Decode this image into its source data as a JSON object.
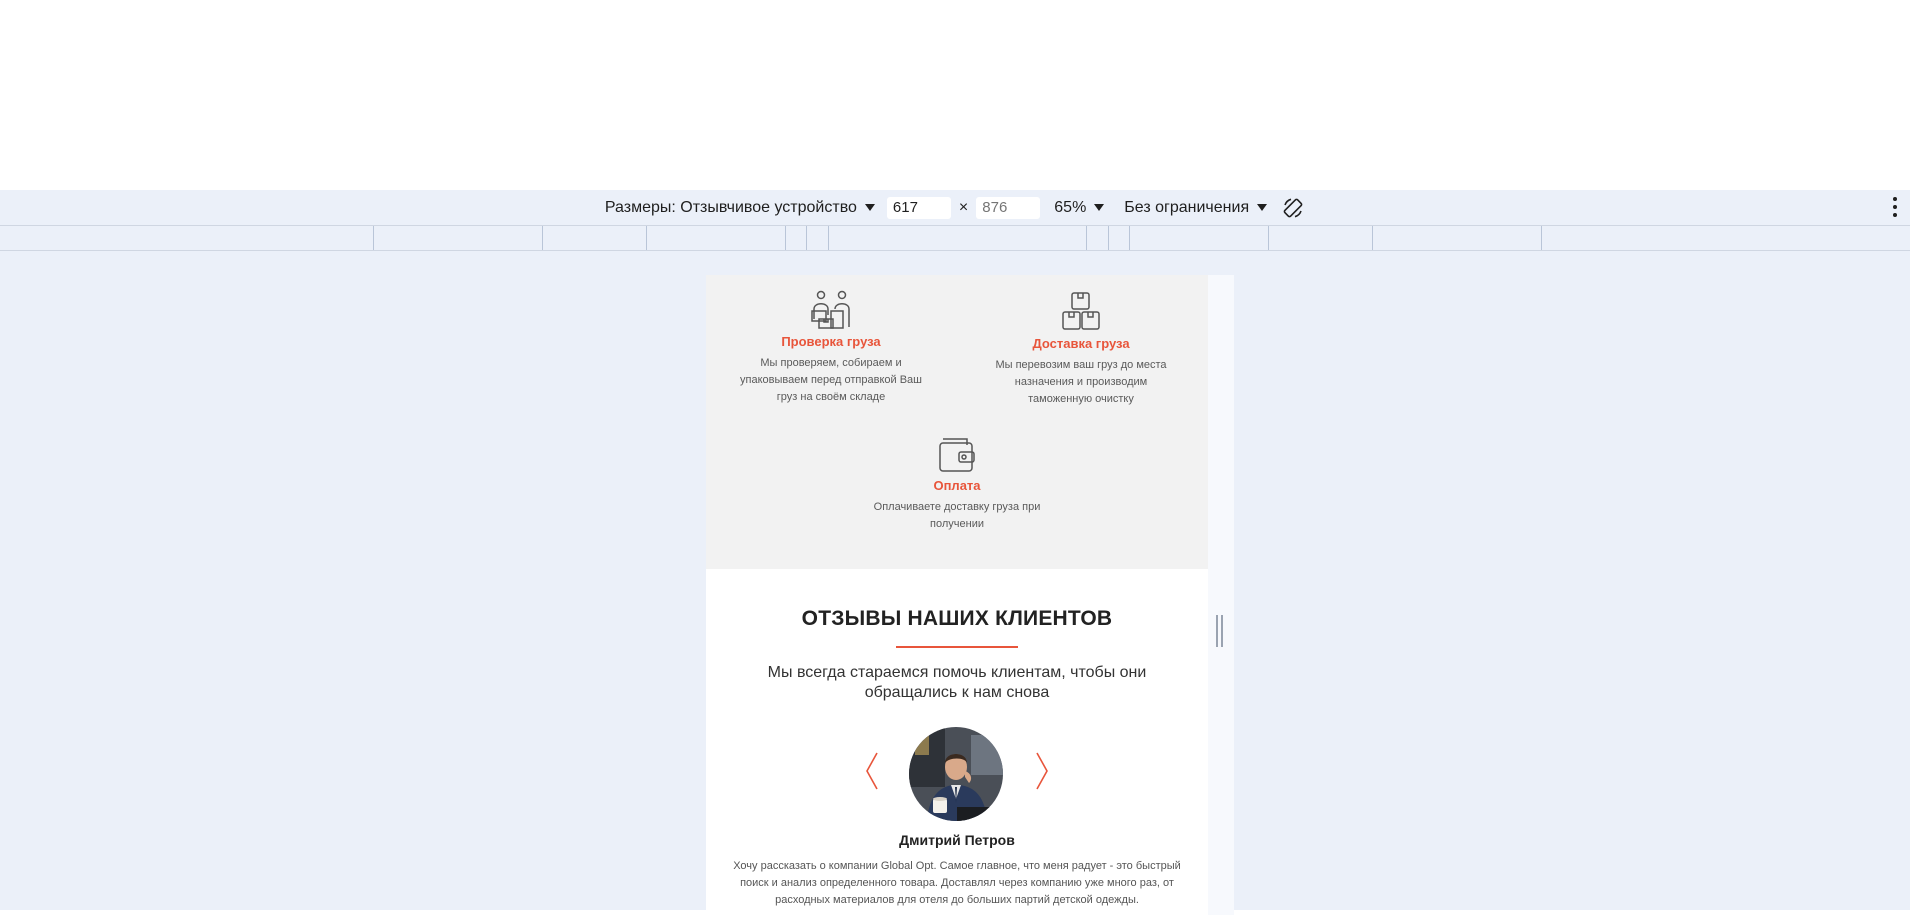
{
  "devtools": {
    "dimensions_label": "Размеры: Отзывчивое устройство",
    "width_value": "617",
    "height_placeholder": "876",
    "times_sign": "×",
    "zoom_label": "65%",
    "throttle_label": "Без ограничения"
  },
  "services": [
    {
      "title": "Проверка груза",
      "description": "Мы проверяем, собираем и упаковываем перед отправкой Ваш груз на своём складе",
      "icon": "workers-boxes-icon"
    },
    {
      "title": "Доставка груза",
      "description": "Мы перевозим ваш груз до места назначения и производим таможенную очистку",
      "icon": "boxes-stack-icon"
    },
    {
      "title": "Оплата",
      "description": "Оплачиваете доставку груза при получении",
      "icon": "wallet-icon"
    }
  ],
  "reviews": {
    "title": "ОТЗЫВЫ НАШИХ КЛИЕНТОВ",
    "subtitle": "Мы всегда стараемся помочь клиентам, чтобы они обращались к нам снова",
    "reviewer_name": "Дмитрий Петров",
    "review_text": "Хочу рассказать о компании Global Opt. Самое главное, что меня радует - это быстрый поиск и анализ определенного товара. Доставлял через компанию уже много раз, от расходных материалов для отеля до больших партий детской одежды."
  },
  "colors": {
    "accent": "#e8553b",
    "devtools_bg": "#ebf0f9",
    "services_bg": "#f2f2f2"
  }
}
